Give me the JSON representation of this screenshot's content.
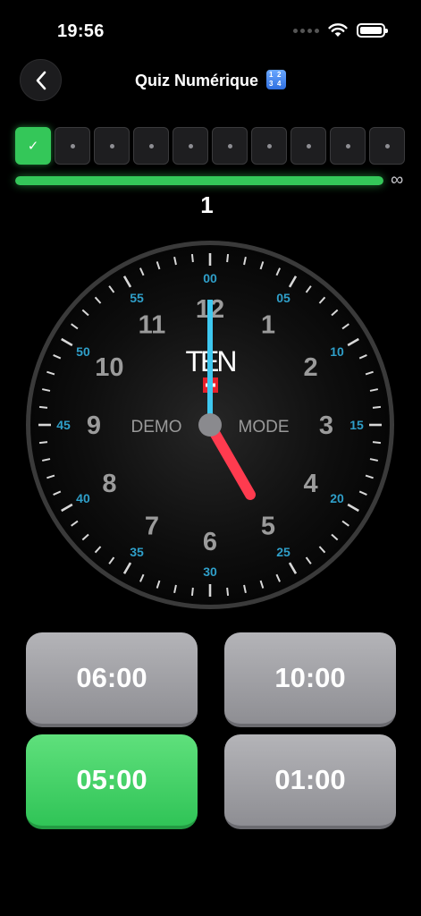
{
  "status_bar": {
    "time": "19:56"
  },
  "header": {
    "title": "Quiz Numérique",
    "emoji_text": [
      "1",
      "2",
      "3",
      "4"
    ]
  },
  "progress": {
    "steps": [
      "done",
      "pending",
      "pending",
      "pending",
      "pending",
      "pending",
      "pending",
      "pending",
      "pending",
      "pending"
    ],
    "check_glyph": "✓",
    "fill_percent": 100,
    "infinity": "∞",
    "question_number": "1"
  },
  "clock": {
    "brand": "TEN",
    "left_label": "DEMO",
    "right_label": "MODE",
    "hours": [
      "12",
      "1",
      "2",
      "3",
      "4",
      "5",
      "6",
      "7",
      "8",
      "9",
      "10",
      "11"
    ],
    "minutes": [
      "00",
      "05",
      "10",
      "15",
      "20",
      "25",
      "30",
      "35",
      "40",
      "45",
      "50",
      "55"
    ],
    "hour_value": 5,
    "minute_value": 0,
    "colors": {
      "hour_hand": "#ff3b4f",
      "minute_hand": "#3ec8f0",
      "minute_numbers": "#2f9fc9"
    }
  },
  "answers": [
    {
      "label": "06:00",
      "state": "grey"
    },
    {
      "label": "10:00",
      "state": "grey"
    },
    {
      "label": "05:00",
      "state": "green"
    },
    {
      "label": "01:00",
      "state": "grey"
    }
  ]
}
